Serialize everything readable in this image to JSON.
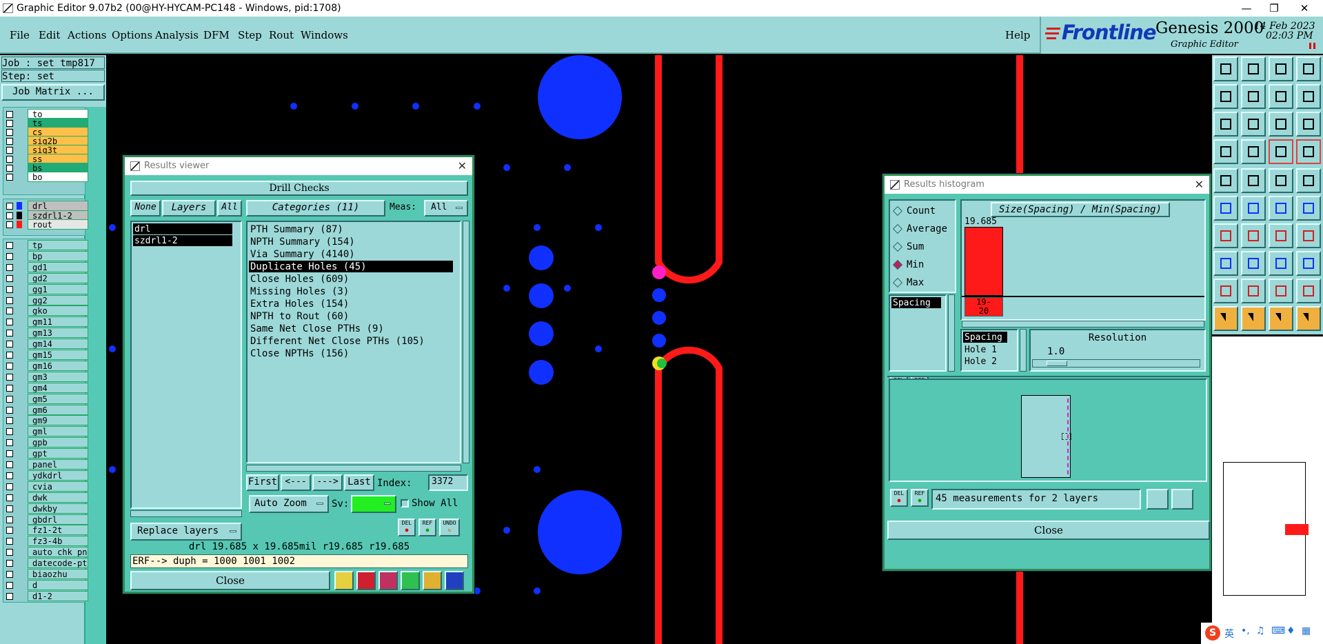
{
  "app": {
    "title": "Graphic Editor 9.07b2 (00@HY-HYCAM-PC148 - Windows, pid:1708)"
  },
  "menu": [
    "File",
    "Edit",
    "Actions",
    "Options",
    "Analysis",
    "DFM",
    "Step",
    "Rout",
    "Windows"
  ],
  "help_label": "Help",
  "brand": {
    "logo": "Frontline",
    "product": "Genesis 2000",
    "subtitle": "Graphic Editor",
    "date": "14 Feb 2023",
    "time": "02:03 PM"
  },
  "job": {
    "job_line": "Job : set_tmp817",
    "step_line": "Step: set",
    "matrix_button": "Job Matrix ..."
  },
  "layers_top": [
    {
      "name": "to",
      "color": "#ffffff"
    },
    {
      "name": "ts",
      "color": "#22aa77"
    },
    {
      "name": "cs",
      "color": "#ffc04a"
    },
    {
      "name": "sig2b",
      "color": "#ffc04a"
    },
    {
      "name": "sig3t",
      "color": "#ffc04a"
    },
    {
      "name": "ss",
      "color": "#ffc04a"
    },
    {
      "name": "bs",
      "color": "#22aa77"
    },
    {
      "name": "bo",
      "color": "#ffffff"
    }
  ],
  "layers_drill": [
    {
      "name": "drl",
      "color": "#bfbfbf",
      "swatch": "#1030ff"
    },
    {
      "name": "szdrl1-2",
      "color": "#bfbfbf",
      "swatch": "#000000"
    },
    {
      "name": "rout",
      "color": "#e6e6e6",
      "swatch": "#ff1a1a"
    }
  ],
  "layers_rest": [
    "tp",
    "bp",
    "gd1",
    "gd2",
    "gg1",
    "gg2",
    "gko",
    "gm11",
    "gm13",
    "gm14",
    "gm15",
    "gm16",
    "gm3",
    "gm4",
    "gm5",
    "gm6",
    "gm9",
    "gml",
    "gpb",
    "gpt",
    "panel",
    "ydkdrl",
    "cvia",
    "dwk",
    "dwkby",
    "gbdrl",
    "fz1-2t",
    "fz3-4b",
    "auto_chk_pn",
    "datecode-pte",
    "biaozhu",
    "d",
    "d1-2"
  ],
  "results_viewer": {
    "title": "Results viewer",
    "header": "Drill Checks",
    "none_btn": "None",
    "layers_btn": "Layers",
    "all_btn": "All",
    "categories_btn": "Categories (11)",
    "meas_label": "Meas:",
    "meas_value": "All",
    "layers": [
      "drl",
      "szdrl1-2"
    ],
    "categories": [
      "PTH Summary (87)",
      "NPTH Summary (154)",
      "Via Summary (4140)",
      "Duplicate Holes (45)",
      "Close Holes (609)",
      "Missing Holes (3)",
      "Extra Holes (154)",
      "NPTH to Rout (60)",
      "Same Net Close PTHs (9)",
      "Different Net Close PTHs (105)",
      "Close NPTHs (156)"
    ],
    "selected_category": "Duplicate Holes (45)",
    "first": "First",
    "prev": "<---",
    "next": "--->",
    "last": "Last",
    "index_label": "Index:",
    "index_value": "3372",
    "auto_zoom": "Auto Zoom",
    "sv_label": "Sv:",
    "show_all": "Show All",
    "replace_layers": "Replace layers",
    "del": "DEL",
    "ref": "REF",
    "undo": "UNDO",
    "info_line": "drl 19.685 x 19.685mil  r19.685  r19.685",
    "erf_line": "ERF--> duph = 1000 1001 1002",
    "close": "Close"
  },
  "results_histogram": {
    "title": "Results histogram",
    "modes": [
      "Count",
      "Average",
      "Sum",
      "Min",
      "Max"
    ],
    "selected_mode": "Min",
    "list_item": "Spacing",
    "chart_title": "Size(Spacing) / Min(Spacing)",
    "bar_value": "19.685",
    "bar_label_1": "19-",
    "bar_label_2": "20",
    "spacing_list": [
      "Spacing",
      "Hole 1",
      "Hole 2"
    ],
    "resolution_label": "Resolution",
    "resolution_value": "1.0",
    "del": "DEL",
    "ref": "REF",
    "summary": "45 measurements for 2 layers",
    "close": "Close"
  },
  "tray": {
    "ime_lang": "英"
  },
  "colors": {
    "panel_bg": "#9dd8d8",
    "dialog_bg": "#56c7b2",
    "pad_blue": "#1030ff",
    "trace_red": "#ff1a1a"
  }
}
